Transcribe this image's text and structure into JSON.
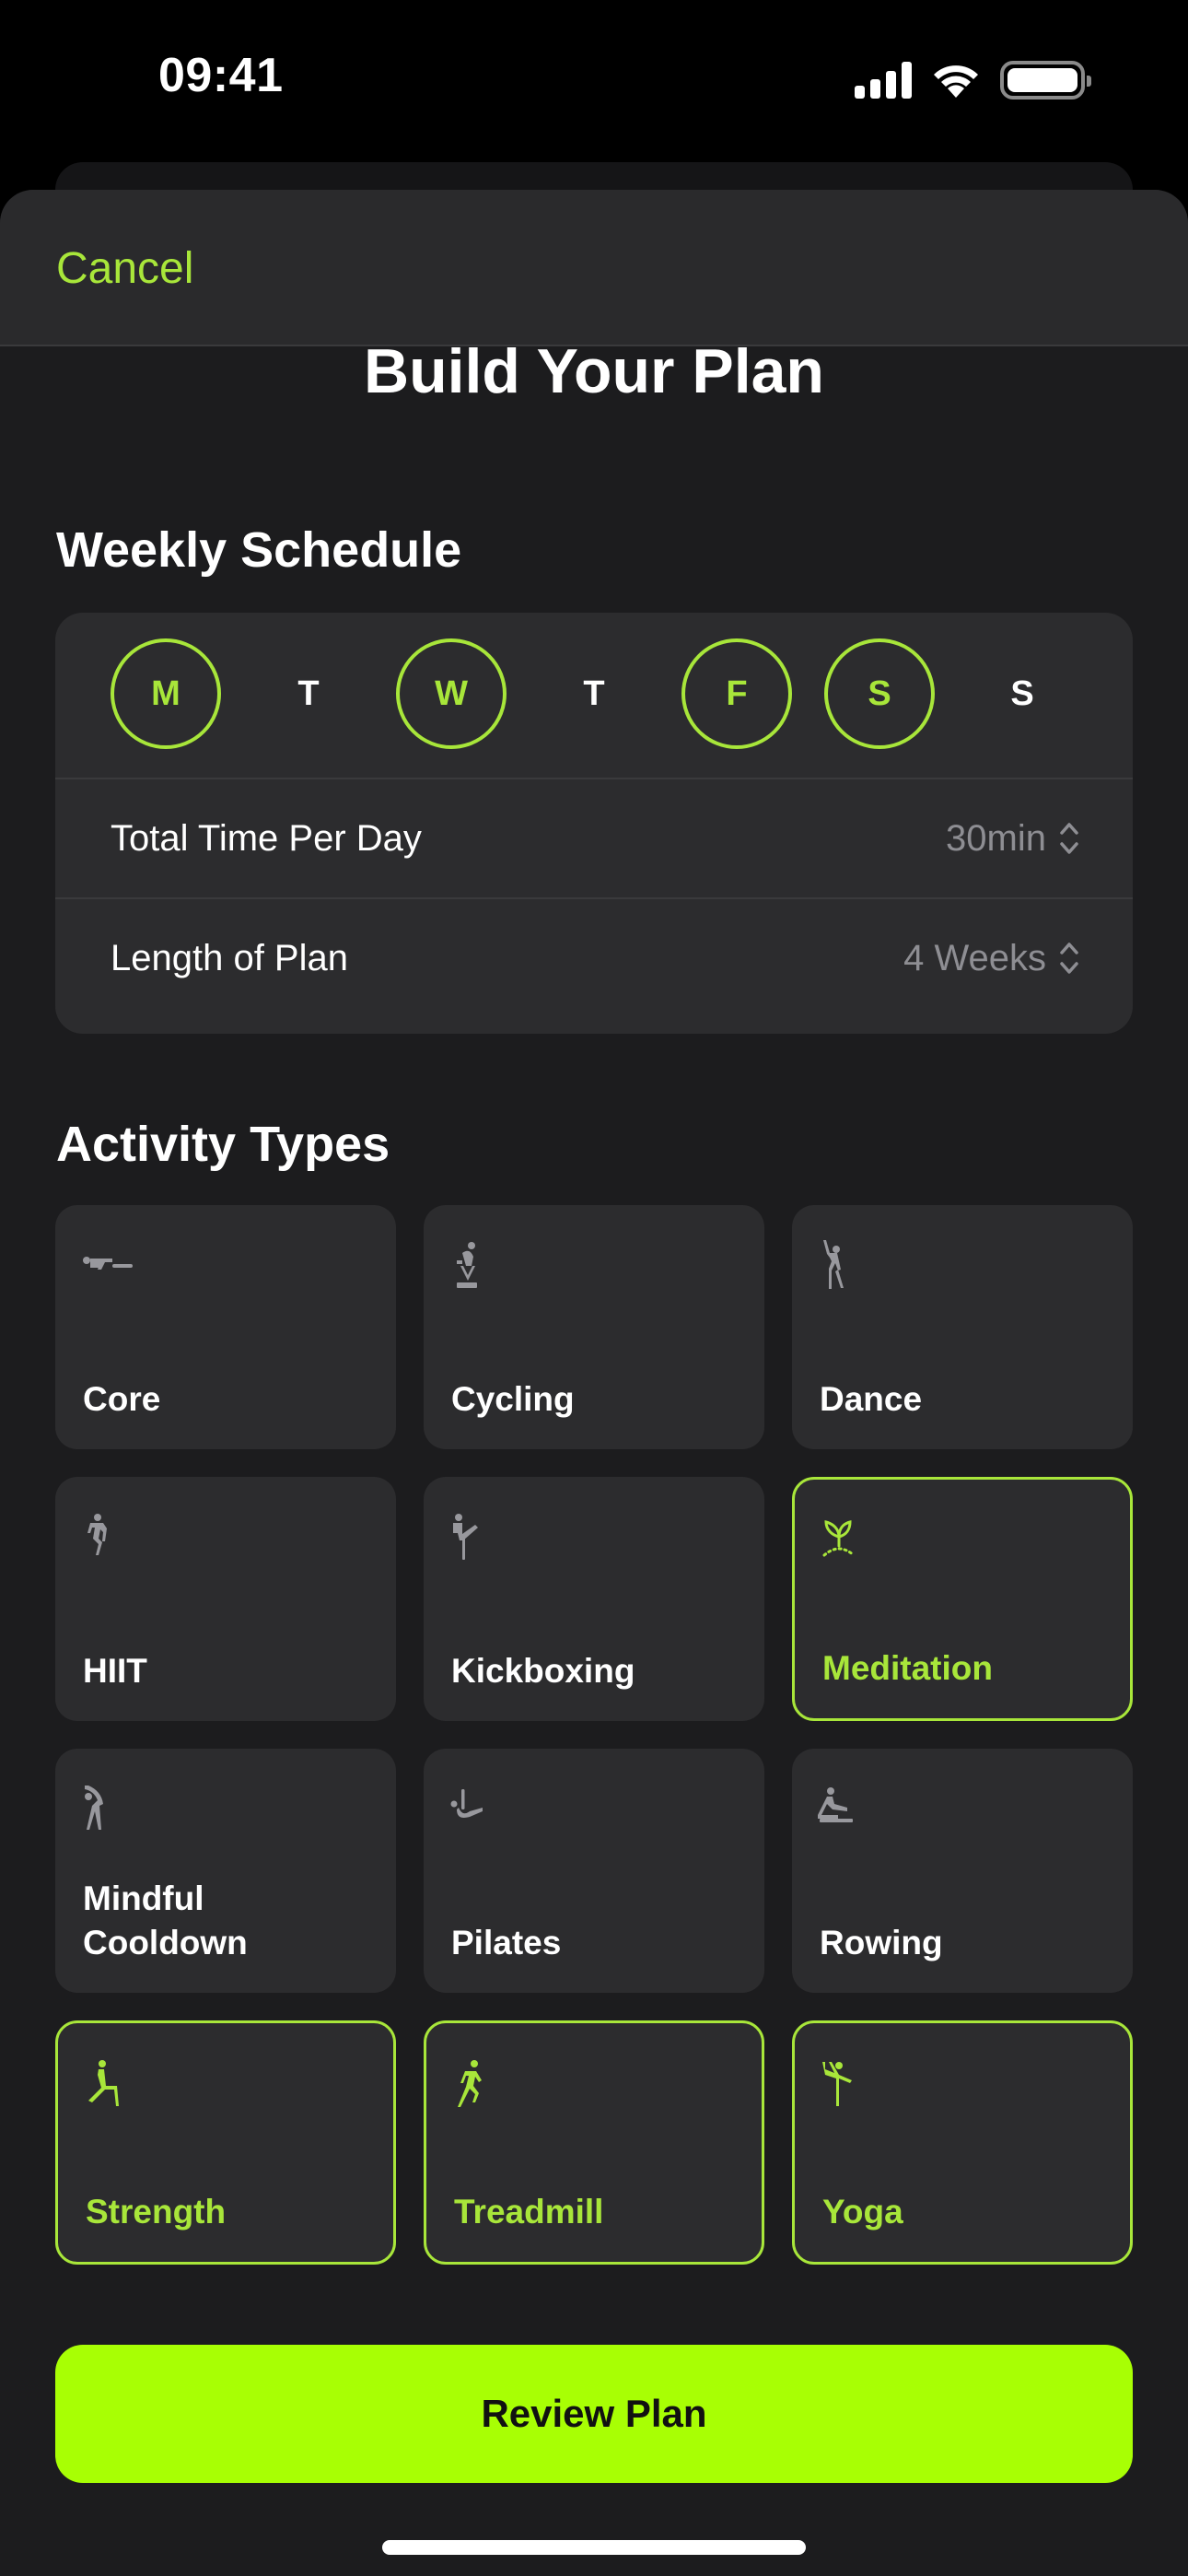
{
  "status_bar": {
    "time": "09:41",
    "icons": [
      "cellular-signal-icon",
      "wifi-icon",
      "battery-icon"
    ]
  },
  "nav": {
    "cancel_label": "Cancel"
  },
  "page_title": "Build Your Plan",
  "accent_color": "#a8e63a",
  "button_color": "#a8ff04",
  "weekly_schedule": {
    "title": "Weekly Schedule",
    "days": [
      {
        "label": "M",
        "name": "Monday",
        "selected": true
      },
      {
        "label": "T",
        "name": "Tuesday",
        "selected": false
      },
      {
        "label": "W",
        "name": "Wednesday",
        "selected": true
      },
      {
        "label": "T",
        "name": "Thursday",
        "selected": false
      },
      {
        "label": "F",
        "name": "Friday",
        "selected": true
      },
      {
        "label": "S",
        "name": "Saturday",
        "selected": true
      },
      {
        "label": "S",
        "name": "Sunday",
        "selected": false
      }
    ],
    "settings": [
      {
        "label": "Total Time Per Day",
        "value": "30min"
      },
      {
        "label": "Length of Plan",
        "value": "4 Weeks"
      }
    ]
  },
  "activity_types": {
    "title": "Activity Types",
    "items": [
      {
        "label": "Core",
        "icon": "core-training-icon",
        "selected": false
      },
      {
        "label": "Cycling",
        "icon": "indoor-cycle-icon",
        "selected": false
      },
      {
        "label": "Dance",
        "icon": "dance-icon",
        "selected": false
      },
      {
        "label": "HIIT",
        "icon": "hiit-icon",
        "selected": false
      },
      {
        "label": "Kickboxing",
        "icon": "kickboxing-icon",
        "selected": false
      },
      {
        "label": "Meditation",
        "icon": "sprout-icon",
        "selected": true
      },
      {
        "label": "Mindful Cooldown",
        "icon": "cooldown-stretch-icon",
        "selected": false
      },
      {
        "label": "Pilates",
        "icon": "pilates-icon",
        "selected": false
      },
      {
        "label": "Rowing",
        "icon": "rowing-icon",
        "selected": false
      },
      {
        "label": "Strength",
        "icon": "strength-icon",
        "selected": true
      },
      {
        "label": "Treadmill",
        "icon": "running-icon",
        "selected": true
      },
      {
        "label": "Yoga",
        "icon": "yoga-icon",
        "selected": true
      }
    ]
  },
  "review_button_label": "Review Plan"
}
